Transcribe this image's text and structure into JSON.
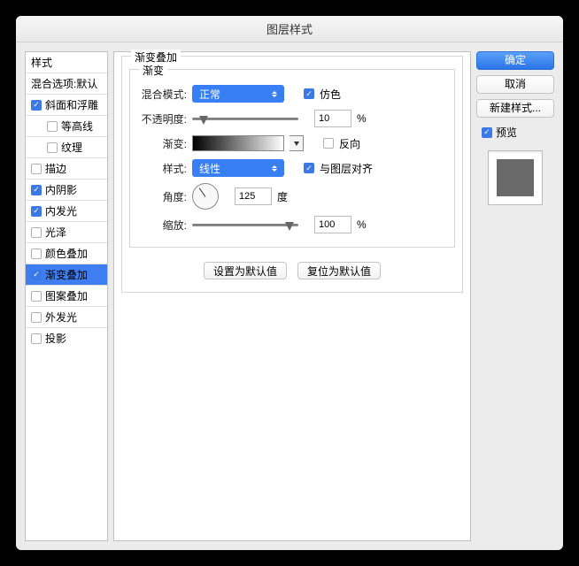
{
  "window_title": "图层样式",
  "sidebar": {
    "header": "样式",
    "blend_options": "混合选项:默认",
    "items": [
      {
        "label": "斜面和浮雕",
        "checked": true,
        "indent": false
      },
      {
        "label": "等高线",
        "checked": false,
        "indent": true
      },
      {
        "label": "纹理",
        "checked": false,
        "indent": true
      },
      {
        "label": "描边",
        "checked": false,
        "indent": false
      },
      {
        "label": "内阴影",
        "checked": true,
        "indent": false
      },
      {
        "label": "内发光",
        "checked": true,
        "indent": false
      },
      {
        "label": "光泽",
        "checked": false,
        "indent": false
      },
      {
        "label": "颜色叠加",
        "checked": false,
        "indent": false
      },
      {
        "label": "渐变叠加",
        "checked": true,
        "indent": false,
        "selected": true
      },
      {
        "label": "图案叠加",
        "checked": false,
        "indent": false
      },
      {
        "label": "外发光",
        "checked": false,
        "indent": false
      },
      {
        "label": "投影",
        "checked": false,
        "indent": false
      }
    ]
  },
  "main": {
    "fieldset_title": "渐变叠加",
    "gradient_title": "渐变",
    "blend_mode_label": "混合模式:",
    "blend_mode_value": "正常",
    "dither_label": "仿色",
    "dither_checked": true,
    "opacity_label": "不透明度:",
    "opacity_value": "10",
    "percent": "%",
    "gradient_label": "渐变:",
    "reverse_label": "反向",
    "reverse_checked": false,
    "style_label": "样式:",
    "style_value": "线性",
    "align_label": "与图层对齐",
    "align_checked": true,
    "angle_label": "角度:",
    "angle_value": "125",
    "degree": "度",
    "scale_label": "缩放:",
    "scale_value": "100",
    "set_default": "设置为默认值",
    "reset_default": "复位为默认值"
  },
  "right": {
    "ok": "确定",
    "cancel": "取消",
    "new_style": "新建样式...",
    "preview_label": "预览",
    "preview_checked": true
  }
}
